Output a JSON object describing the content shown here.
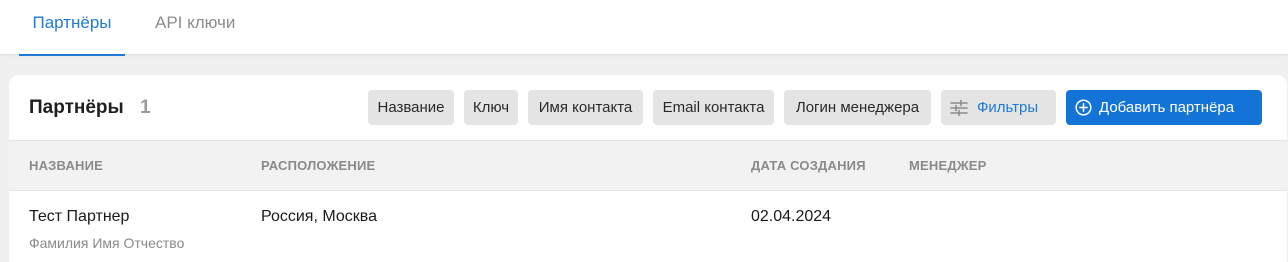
{
  "tabs": [
    {
      "label": "Партнёры",
      "active": true
    },
    {
      "label": "API ключи",
      "active": false
    }
  ],
  "card": {
    "title": "Партнёры",
    "count": "1"
  },
  "search_chips": [
    "Название",
    "Ключ",
    "Имя контакта",
    "Email контакта",
    "Логин менеджера"
  ],
  "filters_button": {
    "label": "Фильтры",
    "icon": "sliders-icon"
  },
  "add_button": {
    "label": "Добавить партнёра",
    "icon": "plus-circle-icon"
  },
  "table": {
    "columns": [
      "НАЗВАНИЕ",
      "РАСПОЛОЖЕНИЕ",
      "ДАТА СОЗДАНИЯ",
      "МЕНЕДЖЕР"
    ],
    "rows": [
      {
        "name": "Тест Партнер",
        "contact": "Фамилия Имя Отчество",
        "location": "Россия, Москва",
        "created": "02.04.2024",
        "manager": ""
      }
    ]
  },
  "colors": {
    "accent": "#1f7ad6",
    "primary_button": "#1473d6",
    "chip_bg": "#e4e4e4",
    "page_bg": "#f0f0f0"
  }
}
